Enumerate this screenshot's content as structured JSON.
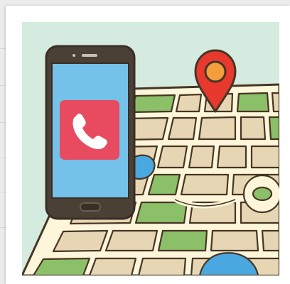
{
  "illustration": {
    "icon": "phone-handset-icon",
    "pin_icon": "map-pin-icon",
    "colors": {
      "sky": "#d6ebe0",
      "road": "#fdf6da",
      "outline": "#473524",
      "block": "#e6d6b4",
      "park": "#8cc068",
      "water": "#4aa8e0",
      "phone_body": "#4b4036",
      "phone_screen": "#74c2ea",
      "call_badge": "#e84a5f",
      "pin_red": "#e8392e",
      "pin_center": "#f29e3a"
    }
  }
}
